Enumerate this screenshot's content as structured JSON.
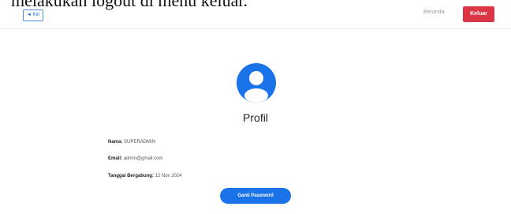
{
  "caption": "melakukan logout di menu keluar.",
  "topbar": {
    "back_label": "◄ Kiri",
    "beranda_label": "Beranda",
    "keluar_label": "Keluar"
  },
  "profile": {
    "title": "Profil",
    "name_label": "Nama:",
    "name_value": "SUPERADMIN",
    "email_label": "Email:",
    "email_value": "admin@gmail.com",
    "joined_label": "Tanggal Bergabung:",
    "joined_value": "12 Nov 2024",
    "change_password_label": "Ganti Password"
  }
}
